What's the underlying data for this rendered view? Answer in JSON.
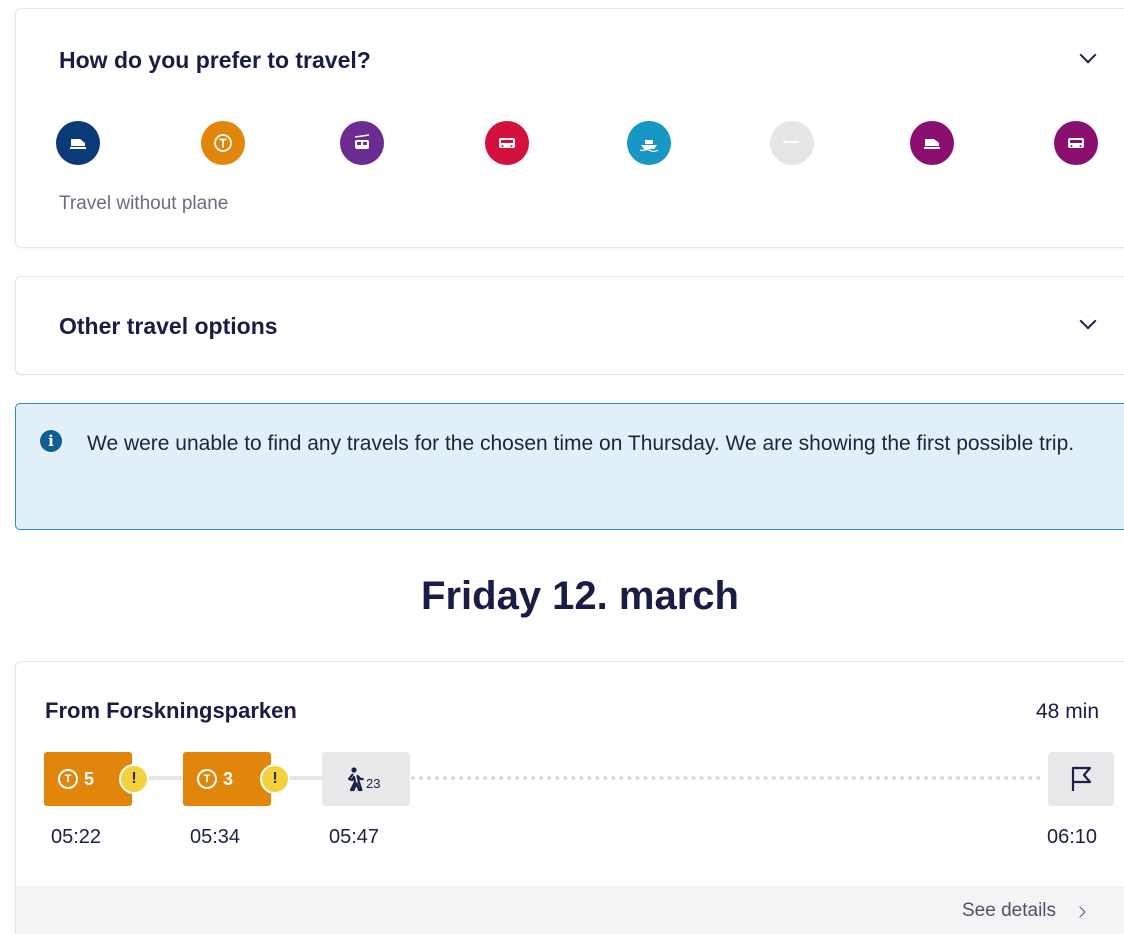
{
  "preferences": {
    "title": "How do you prefer to travel?",
    "modes": [
      {
        "icon": "train-icon",
        "color": "#0b3a78"
      },
      {
        "icon": "tram-icon",
        "color": "#e1860a"
      },
      {
        "icon": "cable-car-icon",
        "color": "#6a2c91"
      },
      {
        "icon": "bus-icon",
        "color": "#d4103f"
      },
      {
        "icon": "ferry-icon",
        "color": "#1896c4"
      },
      {
        "icon": "plane-icon",
        "color": "#e6e6e8"
      },
      {
        "icon": "regional-train-icon",
        "color": "#8a0f6e"
      },
      {
        "icon": "coach-icon",
        "color": "#8a0f6e"
      }
    ],
    "no_plane_label": "Travel without plane"
  },
  "other_options": {
    "title": "Other travel options"
  },
  "info_banner": {
    "icon": "info-icon",
    "text": "We were unable to find any travels for the chosen time on Thursday. We are showing the first possible trip."
  },
  "day_heading": "Friday 12. march",
  "trip": {
    "from": "From Forskningsparken",
    "duration": "48 min",
    "legs": [
      {
        "mode": "tram-icon",
        "line": "5",
        "warning": "!"
      },
      {
        "mode": "tram-icon",
        "line": "3",
        "warning": "!"
      },
      {
        "mode": "walk-icon",
        "minutes": "23"
      },
      {
        "mode": "flag-icon"
      }
    ],
    "times": [
      "05:22",
      "05:34",
      "05:47",
      "06:10"
    ],
    "see_details": "See details"
  }
}
